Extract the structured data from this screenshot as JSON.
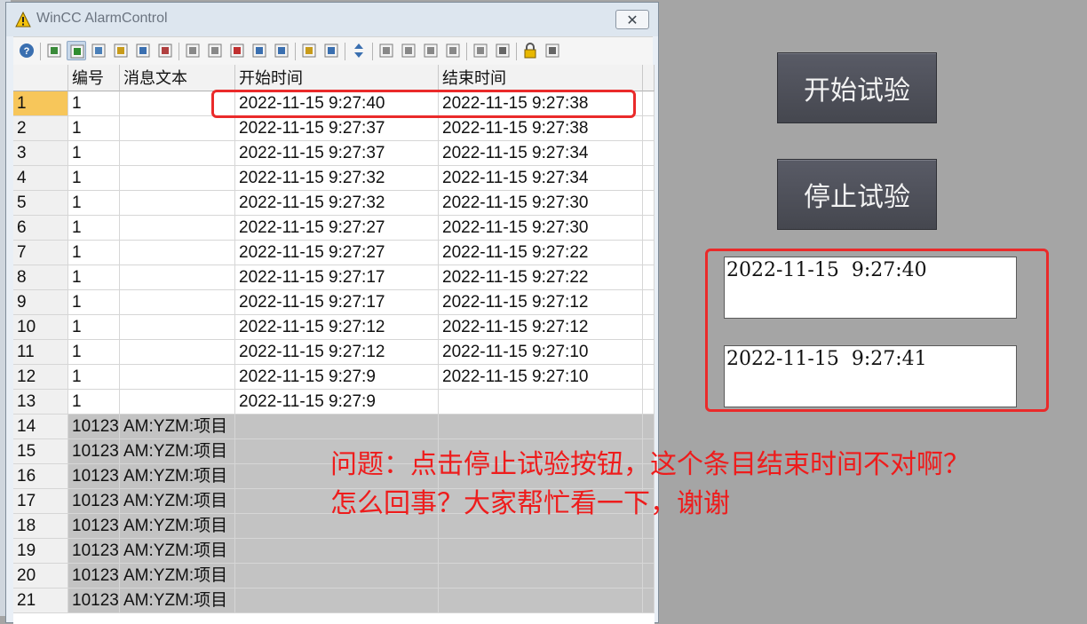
{
  "window": {
    "title": "WinCC AlarmControl",
    "close_glyph": "✕"
  },
  "toolbar": {
    "icons": [
      "help-icon",
      "selection-dialog-icon",
      "message-list-icon",
      "short-term-archive-icon",
      "long-term-archive-icon",
      "lock-list-icon",
      "statistics-icon",
      "single-acknowledge-icon",
      "group-acknowledge-icon",
      "emergency-acknowledge-icon",
      "horn-acknowledge-icon",
      "reporting-icon",
      "export-icon",
      "print-icon",
      "sort-icon",
      "first-message-icon",
      "previous-message-icon",
      "next-message-icon",
      "last-message-icon",
      "properties-icon",
      "comment-icon",
      "lock-icon",
      "more-icon"
    ]
  },
  "table": {
    "columns": [
      "",
      "编号",
      "消息文本",
      "开始时间",
      "结束时间"
    ],
    "rows": [
      {
        "n": "1",
        "num": "1",
        "text": "",
        "start": "2022-11-15  9:27:40",
        "end": "2022-11-15  9:27:38"
      },
      {
        "n": "2",
        "num": "1",
        "text": "",
        "start": "2022-11-15  9:27:37",
        "end": "2022-11-15  9:27:38"
      },
      {
        "n": "3",
        "num": "1",
        "text": "",
        "start": "2022-11-15  9:27:37",
        "end": "2022-11-15  9:27:34"
      },
      {
        "n": "4",
        "num": "1",
        "text": "",
        "start": "2022-11-15  9:27:32",
        "end": "2022-11-15  9:27:34"
      },
      {
        "n": "5",
        "num": "1",
        "text": "",
        "start": "2022-11-15  9:27:32",
        "end": "2022-11-15  9:27:30"
      },
      {
        "n": "6",
        "num": "1",
        "text": "",
        "start": "2022-11-15  9:27:27",
        "end": "2022-11-15  9:27:30"
      },
      {
        "n": "7",
        "num": "1",
        "text": "",
        "start": "2022-11-15  9:27:27",
        "end": "2022-11-15  9:27:22"
      },
      {
        "n": "8",
        "num": "1",
        "text": "",
        "start": "2022-11-15  9:27:17",
        "end": "2022-11-15  9:27:22"
      },
      {
        "n": "9",
        "num": "1",
        "text": "",
        "start": "2022-11-15  9:27:17",
        "end": "2022-11-15  9:27:12"
      },
      {
        "n": "10",
        "num": "1",
        "text": "",
        "start": "2022-11-15  9:27:12",
        "end": "2022-11-15  9:27:12"
      },
      {
        "n": "11",
        "num": "1",
        "text": "",
        "start": "2022-11-15  9:27:12",
        "end": "2022-11-15  9:27:10"
      },
      {
        "n": "12",
        "num": "1",
        "text": "",
        "start": "2022-11-15  9:27:9",
        "end": "2022-11-15  9:27:10"
      },
      {
        "n": "13",
        "num": "1",
        "text": "",
        "start": "2022-11-15  9:27:9",
        "end": ""
      },
      {
        "n": "14",
        "num": "10123",
        "text": "AM:YZM:项目",
        "start": "",
        "end": "",
        "grey": true
      },
      {
        "n": "15",
        "num": "10123",
        "text": "AM:YZM:项目",
        "start": "",
        "end": "",
        "grey": true
      },
      {
        "n": "16",
        "num": "10123",
        "text": "AM:YZM:项目",
        "start": "",
        "end": "",
        "grey": true
      },
      {
        "n": "17",
        "num": "10123",
        "text": "AM:YZM:项目",
        "start": "",
        "end": "",
        "grey": true
      },
      {
        "n": "18",
        "num": "10123",
        "text": "AM:YZM:项目",
        "start": "",
        "end": "",
        "grey": true
      },
      {
        "n": "19",
        "num": "10123",
        "text": "AM:YZM:项目",
        "start": "",
        "end": "",
        "grey": true
      },
      {
        "n": "20",
        "num": "10123",
        "text": "AM:YZM:项目",
        "start": "",
        "end": "",
        "grey": true
      },
      {
        "n": "21",
        "num": "10123",
        "text": "AM:YZM:项目",
        "start": "",
        "end": "",
        "grey": true
      }
    ]
  },
  "controls": {
    "start_button": "开始试验",
    "stop_button": "停止试验",
    "output1": "2022-11-15  9:27:40",
    "output2": "2022-11-15  9:27:41"
  },
  "annotation": {
    "line1": "问题：点击停止试验按钮，这个条目结束时间不对啊？",
    "line2": "怎么回事？大家帮忙看一下，谢谢"
  },
  "colors": {
    "annotation_red": "#ea2a2a",
    "selected_row_header": "#f7c65a",
    "panel_bg": "#a5a5a5"
  }
}
